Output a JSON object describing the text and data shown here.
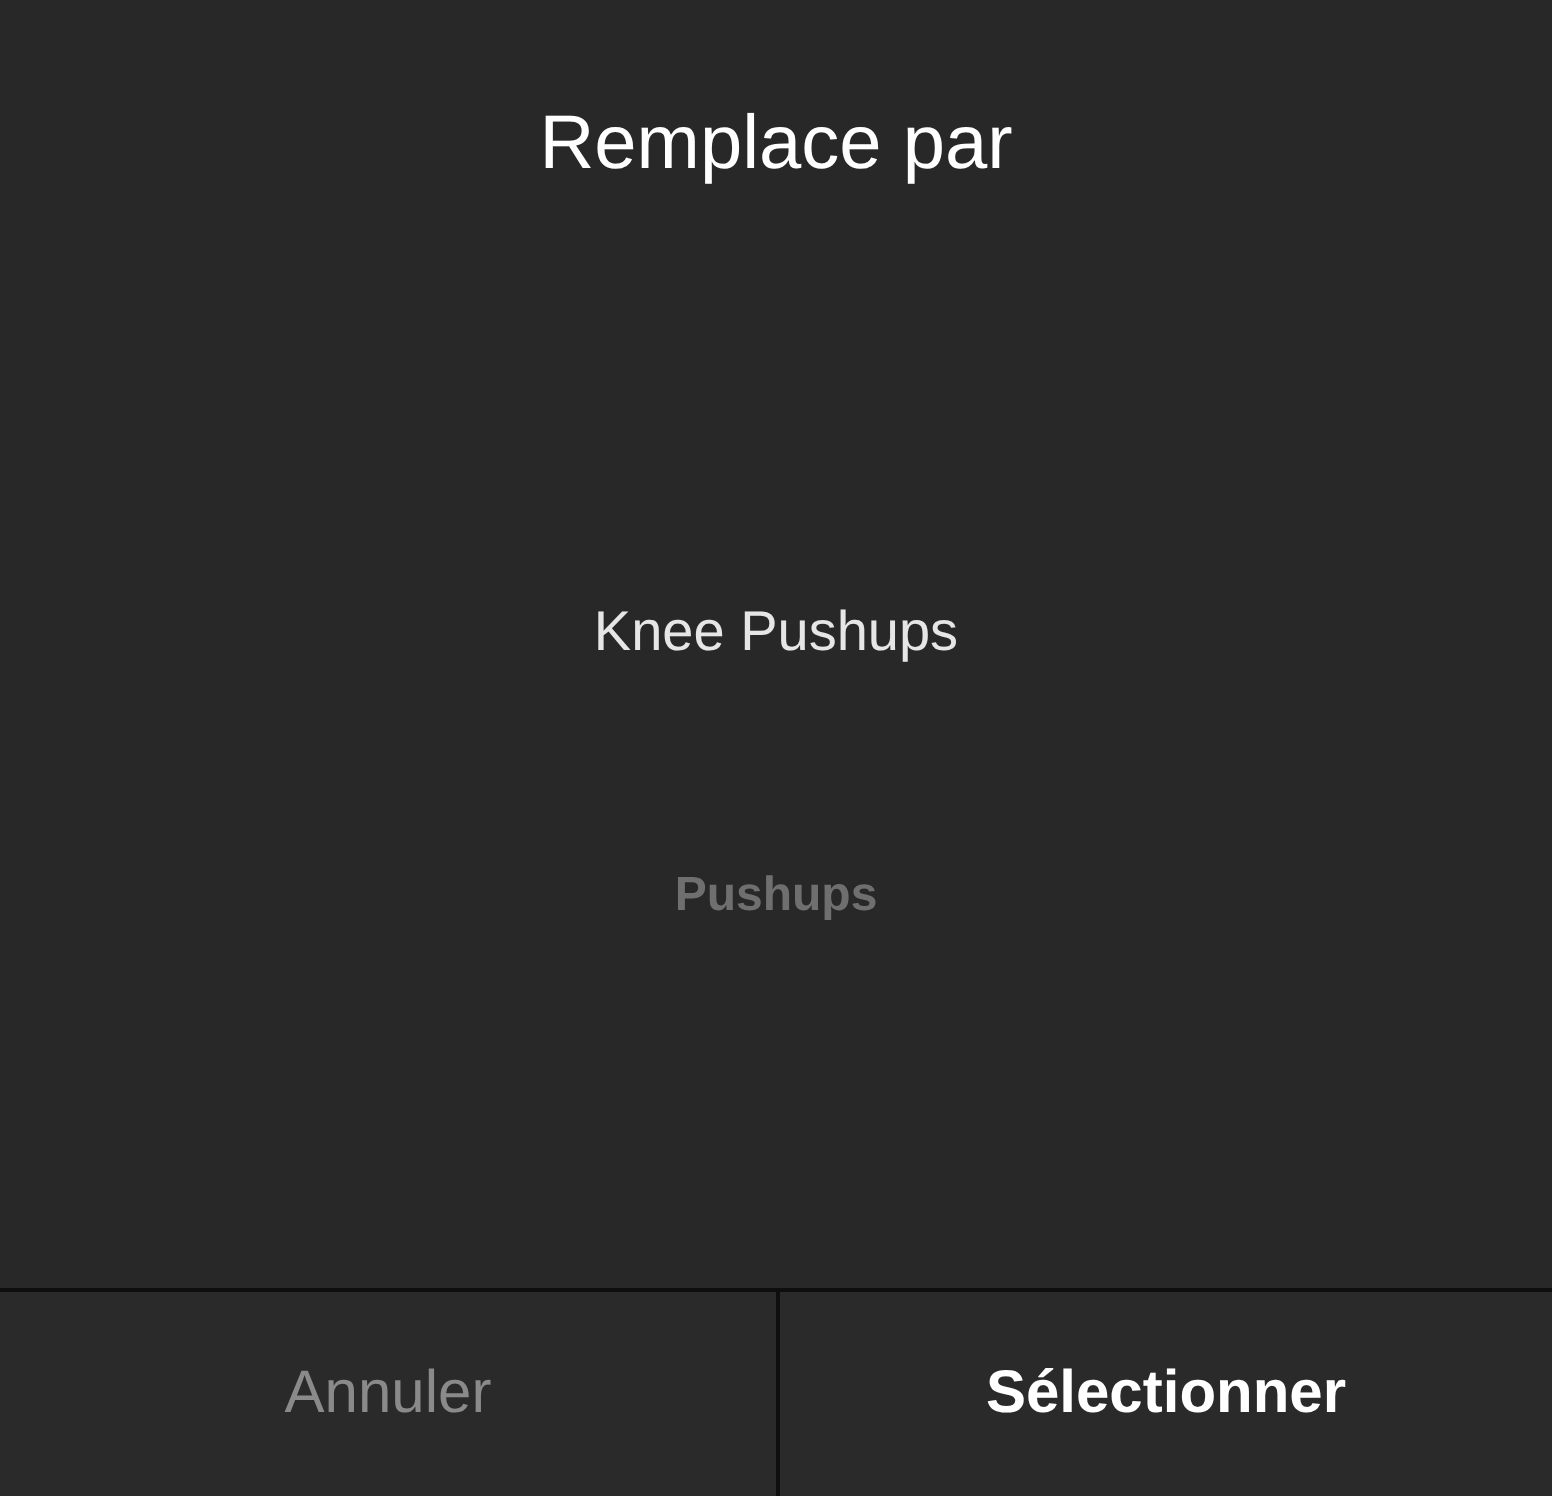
{
  "dialog": {
    "title": "Remplace par"
  },
  "picker": {
    "items": [
      {
        "label": "Knee Pushups",
        "selected": true
      },
      {
        "label": "Pushups",
        "selected": false
      }
    ]
  },
  "buttons": [
    {
      "label": "Annuler",
      "kind": "cancel"
    },
    {
      "label": "Sélectionner",
      "kind": "confirm"
    }
  ]
}
